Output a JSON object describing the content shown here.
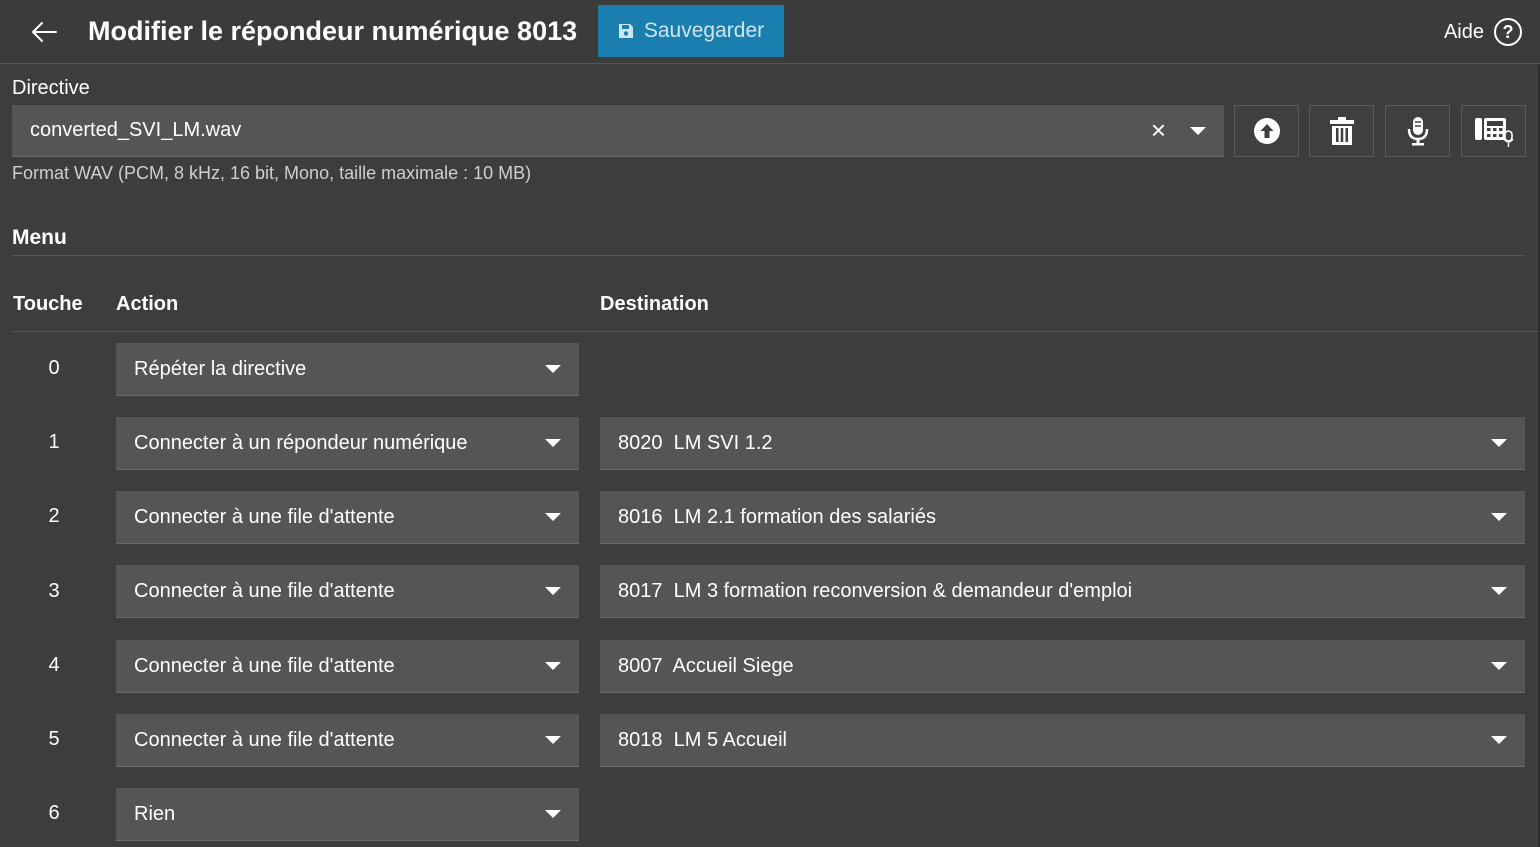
{
  "header": {
    "back_icon": "arrow-left-icon",
    "title": "Modifier le répondeur numérique 8013",
    "save_label": "Sauvegarder",
    "save_icon": "floppy-disk-icon",
    "save_color": "#1a7fae",
    "help_label": "Aide",
    "help_icon": "help-circle-icon"
  },
  "directive": {
    "label": "Directive",
    "value": "converted_SVI_LM.wav",
    "hint": "Format WAV (PCM, 8 kHz, 16 bit, Mono, taille maximale : 10 MB)",
    "buttons": [
      "upload-icon",
      "trash-icon",
      "microphone-icon",
      "phone-record-icon"
    ]
  },
  "menu": {
    "title": "Menu",
    "columns": {
      "key": "Touche",
      "action": "Action",
      "destination": "Destination"
    },
    "rows": [
      {
        "key": "0",
        "action": "Répéter la directive",
        "destination": ""
      },
      {
        "key": "1",
        "action": "Connecter à un répondeur numérique",
        "destination": "8020  LM SVI 1.2"
      },
      {
        "key": "2",
        "action": "Connecter à une file d'attente",
        "destination": "8016  LM 2.1 formation des salariés"
      },
      {
        "key": "3",
        "action": "Connecter à une file d'attente",
        "destination": "8017  LM 3 formation reconversion & demandeur d'emploi"
      },
      {
        "key": "4",
        "action": "Connecter à une file d'attente",
        "destination": "8007  Accueil Siege"
      },
      {
        "key": "5",
        "action": "Connecter à une file d'attente",
        "destination": "8018  LM 5 Accueil"
      },
      {
        "key": "6",
        "action": "Rien",
        "destination": ""
      }
    ]
  }
}
